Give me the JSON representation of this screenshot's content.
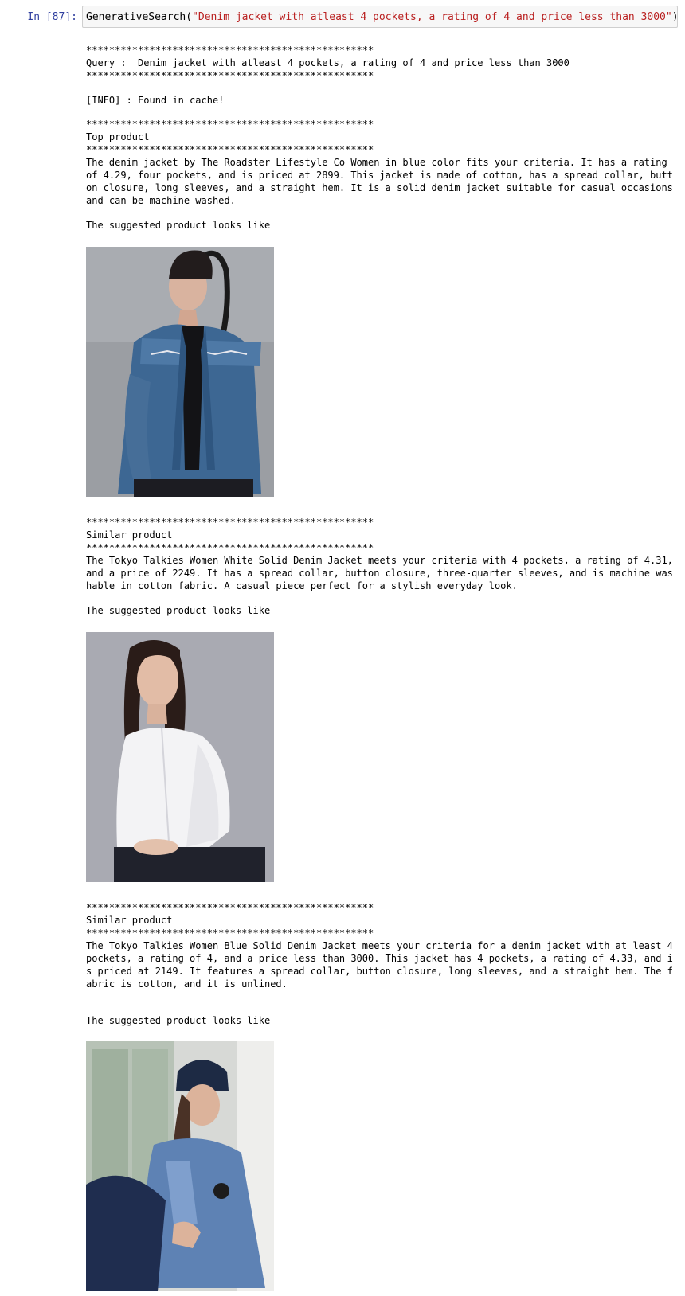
{
  "cell": {
    "prompt": "In [87]:",
    "code_fn": "GenerativeSearch(",
    "code_arg": "\"Denim jacket with atleast 4 pockets, a rating of 4 and price less than 3000\"",
    "code_close": ")"
  },
  "output": {
    "divider": "**************************************************",
    "query_line": "Query :  Denim jacket with atleast 4 pockets, a rating of 4 and price less than 3000",
    "info_line": "[INFO] : Found in cache!",
    "suggested_label": "The suggested product looks like",
    "products": [
      {
        "heading": "Top product",
        "description": "The denim jacket by The Roadster Lifestyle Co Women in blue color fits your criteria. It has a rating of 4.29, four pockets, and is priced at 2899. This jacket is made of cotton, has a spread collar, button closure, long sleeves, and a straight hem. It is a solid denim jacket suitable for casual occasions and can be machine-washed."
      },
      {
        "heading": "Similar product",
        "description": "The Tokyo Talkies Women White Solid Denim Jacket meets your criteria with 4 pockets, a rating of 4.31, and a price of 2249. It has a spread collar, button closure, three-quarter sleeves, and is machine washable in cotton fabric. A casual piece perfect for a stylish everyday look."
      },
      {
        "heading": "Similar product",
        "description": "The Tokyo Talkies Women Blue Solid Denim Jacket meets your criteria for a denim jacket with at least 4 pockets, a rating of 4, and a price less than 3000. This jacket has 4 pockets, a rating of 4.33, and is priced at 2149. It features a spread collar, button closure, long sleeves, and a straight hem. The fabric is cotton, and it is unlined."
      }
    ]
  },
  "colors": {
    "prompt": "#303f9f",
    "string_literal": "#ba2121",
    "input_bg": "#f7f7f7",
    "input_border": "#cfcfcf"
  }
}
